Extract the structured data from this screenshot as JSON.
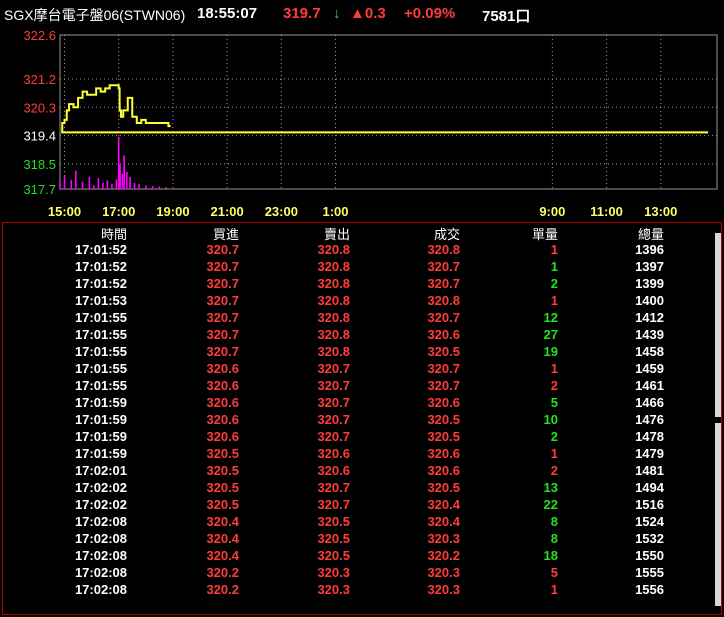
{
  "header": {
    "title": "SGX摩台電子盤06(STWN06)",
    "time": "18:55:07",
    "price": "319.7",
    "direction_glyph": "↓",
    "change": "▲0.3",
    "change_pct": "+0.09%",
    "volume": "7581口"
  },
  "colors": {
    "up": "#ff3b3b",
    "down": "#22e022",
    "line": "#ffff33",
    "volume_bar": "#ff00ff",
    "grid": "#9a9a9a"
  },
  "chart_data": {
    "type": "line",
    "y_ticks": [
      "322.6",
      "321.2",
      "320.3",
      "319.4",
      "318.5",
      "317.7"
    ],
    "x_ticks": [
      "15:00",
      "17:00",
      "19:00",
      "21:00",
      "23:00",
      "1:00",
      "9:00",
      "11:00",
      "13:00"
    ],
    "ylim": [
      317.7,
      322.6
    ],
    "price_series": {
      "x": [
        "14:45",
        "14:55",
        "15:00",
        "15:05",
        "15:10",
        "15:20",
        "15:30",
        "15:40",
        "15:50",
        "16:00",
        "16:10",
        "16:20",
        "16:30",
        "16:40",
        "16:50",
        "17:00",
        "17:02",
        "17:05",
        "17:10",
        "17:20",
        "17:30",
        "17:40",
        "17:50",
        "18:00",
        "18:10",
        "18:20",
        "18:30",
        "18:40",
        "18:50",
        "18:55"
      ],
      "values": [
        319.5,
        319.8,
        319.9,
        320.2,
        320.4,
        320.3,
        320.6,
        320.8,
        320.7,
        320.7,
        320.9,
        320.8,
        320.9,
        321.0,
        321.0,
        320.9,
        320.2,
        320.0,
        320.2,
        320.6,
        320.0,
        319.8,
        319.9,
        319.8,
        319.8,
        319.8,
        319.8,
        319.8,
        319.7,
        319.7
      ]
    },
    "volume_series": {
      "x": [
        "14:50",
        "15:00",
        "15:15",
        "15:25",
        "15:40",
        "15:55",
        "16:05",
        "16:15",
        "16:25",
        "16:35",
        "16:45",
        "16:55",
        "17:00",
        "17:03",
        "17:08",
        "17:12",
        "17:18",
        "17:25",
        "17:35",
        "17:45",
        "18:00",
        "18:15",
        "18:30",
        "18:45"
      ],
      "values": [
        10,
        22,
        15,
        30,
        12,
        20,
        6,
        18,
        10,
        14,
        8,
        16,
        85,
        40,
        25,
        55,
        28,
        20,
        10,
        8,
        6,
        5,
        4,
        3
      ]
    }
  },
  "table": {
    "headers": [
      "時間",
      "買進",
      "賣出",
      "成交",
      "單量",
      "總量"
    ],
    "rows": [
      {
        "time": "17:01:52",
        "bid": "320.7",
        "ask": "320.8",
        "last": "320.8",
        "qty": "1",
        "qty_dir": "up",
        "total": "1396"
      },
      {
        "time": "17:01:52",
        "bid": "320.7",
        "ask": "320.8",
        "last": "320.7",
        "qty": "1",
        "qty_dir": "dn",
        "total": "1397"
      },
      {
        "time": "17:01:52",
        "bid": "320.7",
        "ask": "320.8",
        "last": "320.7",
        "qty": "2",
        "qty_dir": "dn",
        "total": "1399"
      },
      {
        "time": "17:01:53",
        "bid": "320.7",
        "ask": "320.8",
        "last": "320.8",
        "qty": "1",
        "qty_dir": "up",
        "total": "1400"
      },
      {
        "time": "17:01:55",
        "bid": "320.7",
        "ask": "320.8",
        "last": "320.7",
        "qty": "12",
        "qty_dir": "dn",
        "total": "1412"
      },
      {
        "time": "17:01:55",
        "bid": "320.7",
        "ask": "320.8",
        "last": "320.6",
        "qty": "27",
        "qty_dir": "dn",
        "total": "1439"
      },
      {
        "time": "17:01:55",
        "bid": "320.7",
        "ask": "320.8",
        "last": "320.5",
        "qty": "19",
        "qty_dir": "dn",
        "total": "1458"
      },
      {
        "time": "17:01:55",
        "bid": "320.6",
        "ask": "320.7",
        "last": "320.7",
        "qty": "1",
        "qty_dir": "up",
        "total": "1459"
      },
      {
        "time": "17:01:55",
        "bid": "320.6",
        "ask": "320.7",
        "last": "320.7",
        "qty": "2",
        "qty_dir": "up",
        "total": "1461"
      },
      {
        "time": "17:01:59",
        "bid": "320.6",
        "ask": "320.7",
        "last": "320.6",
        "qty": "5",
        "qty_dir": "dn",
        "total": "1466"
      },
      {
        "time": "17:01:59",
        "bid": "320.6",
        "ask": "320.7",
        "last": "320.5",
        "qty": "10",
        "qty_dir": "dn",
        "total": "1476"
      },
      {
        "time": "17:01:59",
        "bid": "320.6",
        "ask": "320.7",
        "last": "320.5",
        "qty": "2",
        "qty_dir": "dn",
        "total": "1478"
      },
      {
        "time": "17:01:59",
        "bid": "320.5",
        "ask": "320.6",
        "last": "320.6",
        "qty": "1",
        "qty_dir": "up",
        "total": "1479"
      },
      {
        "time": "17:02:01",
        "bid": "320.5",
        "ask": "320.6",
        "last": "320.6",
        "qty": "2",
        "qty_dir": "up",
        "total": "1481"
      },
      {
        "time": "17:02:02",
        "bid": "320.5",
        "ask": "320.7",
        "last": "320.5",
        "qty": "13",
        "qty_dir": "dn",
        "total": "1494"
      },
      {
        "time": "17:02:02",
        "bid": "320.5",
        "ask": "320.7",
        "last": "320.4",
        "qty": "22",
        "qty_dir": "dn",
        "total": "1516"
      },
      {
        "time": "17:02:08",
        "bid": "320.4",
        "ask": "320.5",
        "last": "320.4",
        "qty": "8",
        "qty_dir": "dn",
        "total": "1524"
      },
      {
        "time": "17:02:08",
        "bid": "320.4",
        "ask": "320.5",
        "last": "320.3",
        "qty": "8",
        "qty_dir": "dn",
        "total": "1532"
      },
      {
        "time": "17:02:08",
        "bid": "320.4",
        "ask": "320.5",
        "last": "320.2",
        "qty": "18",
        "qty_dir": "dn",
        "total": "1550"
      },
      {
        "time": "17:02:08",
        "bid": "320.2",
        "ask": "320.3",
        "last": "320.3",
        "qty": "5",
        "qty_dir": "up",
        "total": "1555"
      },
      {
        "time": "17:02:08",
        "bid": "320.2",
        "ask": "320.3",
        "last": "320.3",
        "qty": "1",
        "qty_dir": "up",
        "total": "1556"
      }
    ]
  }
}
